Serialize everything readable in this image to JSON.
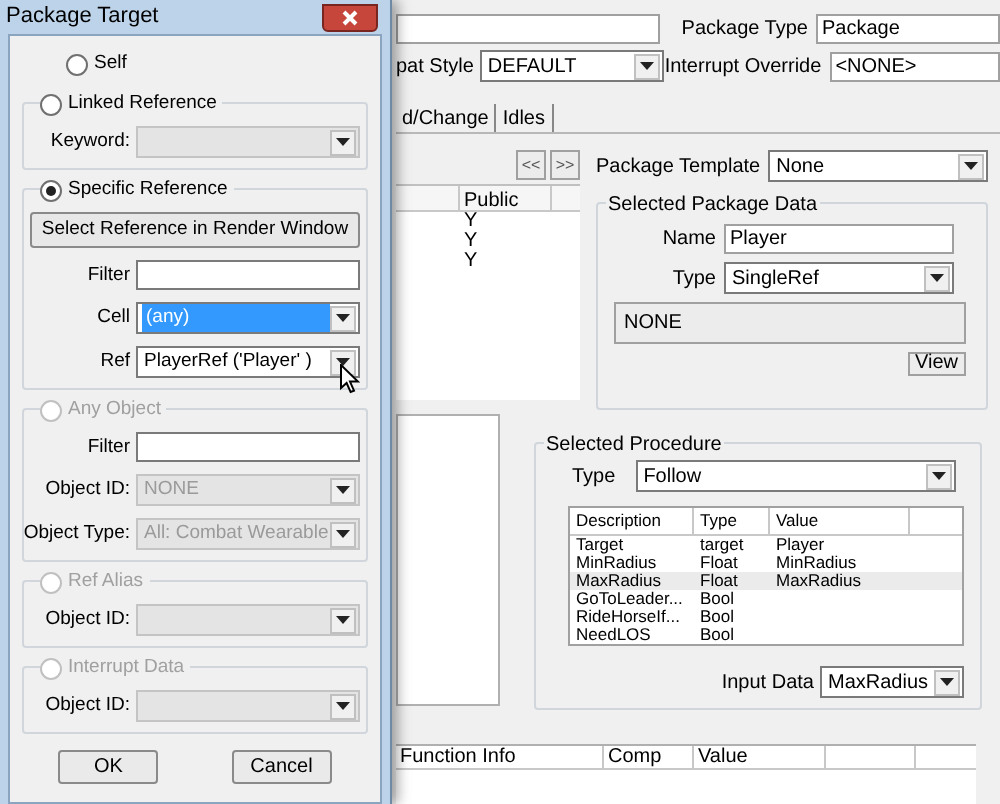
{
  "dialog": {
    "title": "Package Target",
    "options": [
      {
        "kind": "radio",
        "label": "Self",
        "selected": false,
        "disabled": false
      },
      {
        "kind": "group",
        "label": "Linked Reference",
        "selected": false,
        "disabled": false,
        "rows": [
          {
            "kind": "dropdown",
            "label": "Keyword:",
            "disabled": true
          }
        ]
      },
      {
        "kind": "group",
        "label": "Specific Reference",
        "selected": true,
        "disabled": false,
        "rows": [
          {
            "kind": "button",
            "label": "Select Reference in Render Window"
          },
          {
            "kind": "text",
            "label": "Filter",
            "disabled": false
          },
          {
            "kind": "dropdown",
            "label": "Cell",
            "value": "(any)",
            "highlighted": true,
            "disabled": false
          },
          {
            "kind": "dropdown",
            "label": "Ref",
            "value": "PlayerRef ('Player' )",
            "highlighted": false,
            "disabled": false
          }
        ]
      },
      {
        "kind": "group",
        "label": "Any Object",
        "selected": false,
        "disabled": true,
        "rows": [
          {
            "kind": "text",
            "label": "Filter",
            "disabled": false
          },
          {
            "kind": "dropdown",
            "label": "Object ID:",
            "value": "NONE",
            "disabled": true
          },
          {
            "kind": "dropdown",
            "label": "Object Type:",
            "value": "All: Combat Wearable",
            "disabled": true
          }
        ]
      },
      {
        "kind": "group",
        "label": "Ref Alias",
        "selected": false,
        "disabled": true,
        "rows": [
          {
            "kind": "dropdown",
            "label": "Object ID:",
            "disabled": true
          }
        ]
      },
      {
        "kind": "group",
        "label": "Interrupt Data",
        "selected": false,
        "disabled": true,
        "rows": [
          {
            "kind": "dropdown",
            "label": "Object ID:",
            "disabled": true
          }
        ]
      }
    ],
    "buttons": [
      "OK",
      "Cancel"
    ]
  },
  "main": {
    "package_type": {
      "label": "Package Type",
      "value": "Package"
    },
    "combat_style": {
      "label": "pat Style",
      "value": "DEFAULT"
    },
    "interrupt_override": {
      "label": "Interrupt Override",
      "value": "<NONE>"
    },
    "tabs": [
      {
        "label": "d/Change",
        "selected": false
      },
      {
        "label": "Idles",
        "selected": false
      }
    ],
    "nav_buttons": [
      "<<",
      ">>"
    ],
    "left_table": {
      "columns": [
        "Public"
      ],
      "rows": [
        [
          "Y"
        ],
        [
          "Y"
        ],
        [
          "Y"
        ]
      ]
    },
    "package_template": {
      "label": "Package Template",
      "value": "None"
    },
    "package_data": {
      "title": "Selected Package Data",
      "name": {
        "label": "Name",
        "value": "Player"
      },
      "type": {
        "label": "Type",
        "value": "SingleRef"
      },
      "ref_button": "NONE",
      "view_button": "View"
    },
    "procedure": {
      "title": "Selected Procedure",
      "type": {
        "label": "Type",
        "value": "Follow"
      },
      "columns": [
        "Description",
        "Type",
        "Value"
      ],
      "rows": [
        {
          "cells": [
            "Target",
            "target",
            "Player"
          ],
          "selected": false
        },
        {
          "cells": [
            "MinRadius",
            "Float",
            "MinRadius"
          ],
          "selected": false
        },
        {
          "cells": [
            "MaxRadius",
            "Float",
            "MaxRadius"
          ],
          "selected": true
        },
        {
          "cells": [
            "GoToLeader...",
            "Bool"
          ],
          "selected": false
        },
        {
          "cells": [
            "RideHorseIf...",
            "Bool"
          ],
          "selected": false
        },
        {
          "cells": [
            "NeedLOS",
            "Bool"
          ],
          "selected": false
        }
      ],
      "input_data": {
        "label": "Input Data",
        "value": "MaxRadius"
      }
    },
    "bottom_table": {
      "columns": [
        "Function Info",
        "Comp",
        "Value"
      ]
    }
  }
}
